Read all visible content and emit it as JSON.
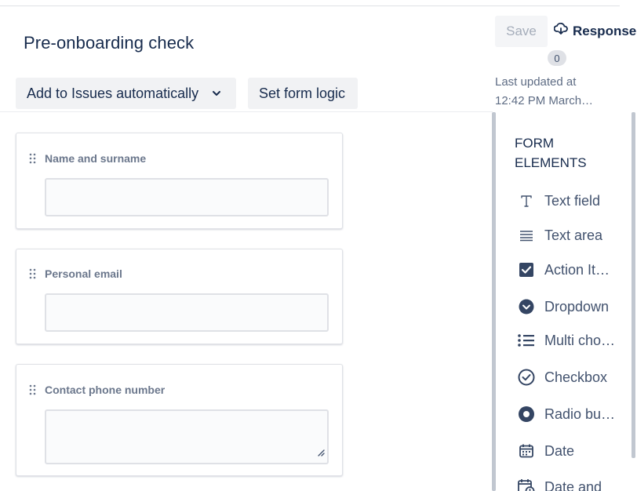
{
  "form": {
    "title": "Pre-onboarding check",
    "add_to_issues_label": "Add to Issues automatically",
    "form_logic_label": "Set form logic"
  },
  "actions": {
    "save_label": "Save",
    "responses_label": "Responses",
    "responses_count": "0",
    "last_updated_line1": "Last updated at",
    "last_updated_line2": "12:42 PM March…"
  },
  "fields": [
    {
      "label": "Name and surname"
    },
    {
      "label": "Personal email"
    },
    {
      "label": "Contact phone number"
    }
  ],
  "sidebar": {
    "title": "FORM ELEMENTS",
    "items": [
      {
        "label": "Text field",
        "icon": "text-field-icon"
      },
      {
        "label": "Text area",
        "icon": "text-area-icon"
      },
      {
        "label": "Action It…",
        "icon": "action-item-icon"
      },
      {
        "label": "Dropdown",
        "icon": "dropdown-icon"
      },
      {
        "label": "Multi cho…",
        "icon": "multiple-choice-icon"
      },
      {
        "label": "Checkbox",
        "icon": "checkbox-icon"
      },
      {
        "label": "Radio bu…",
        "icon": "radio-button-icon"
      },
      {
        "label": "Date",
        "icon": "date-icon"
      },
      {
        "label": "Date and",
        "icon": "date-time-icon"
      }
    ]
  },
  "colors": {
    "text_primary": "#172b4d",
    "text_secondary": "#6b778c",
    "button_bg": "#f1f2f4",
    "icon_dark": "#344563"
  }
}
